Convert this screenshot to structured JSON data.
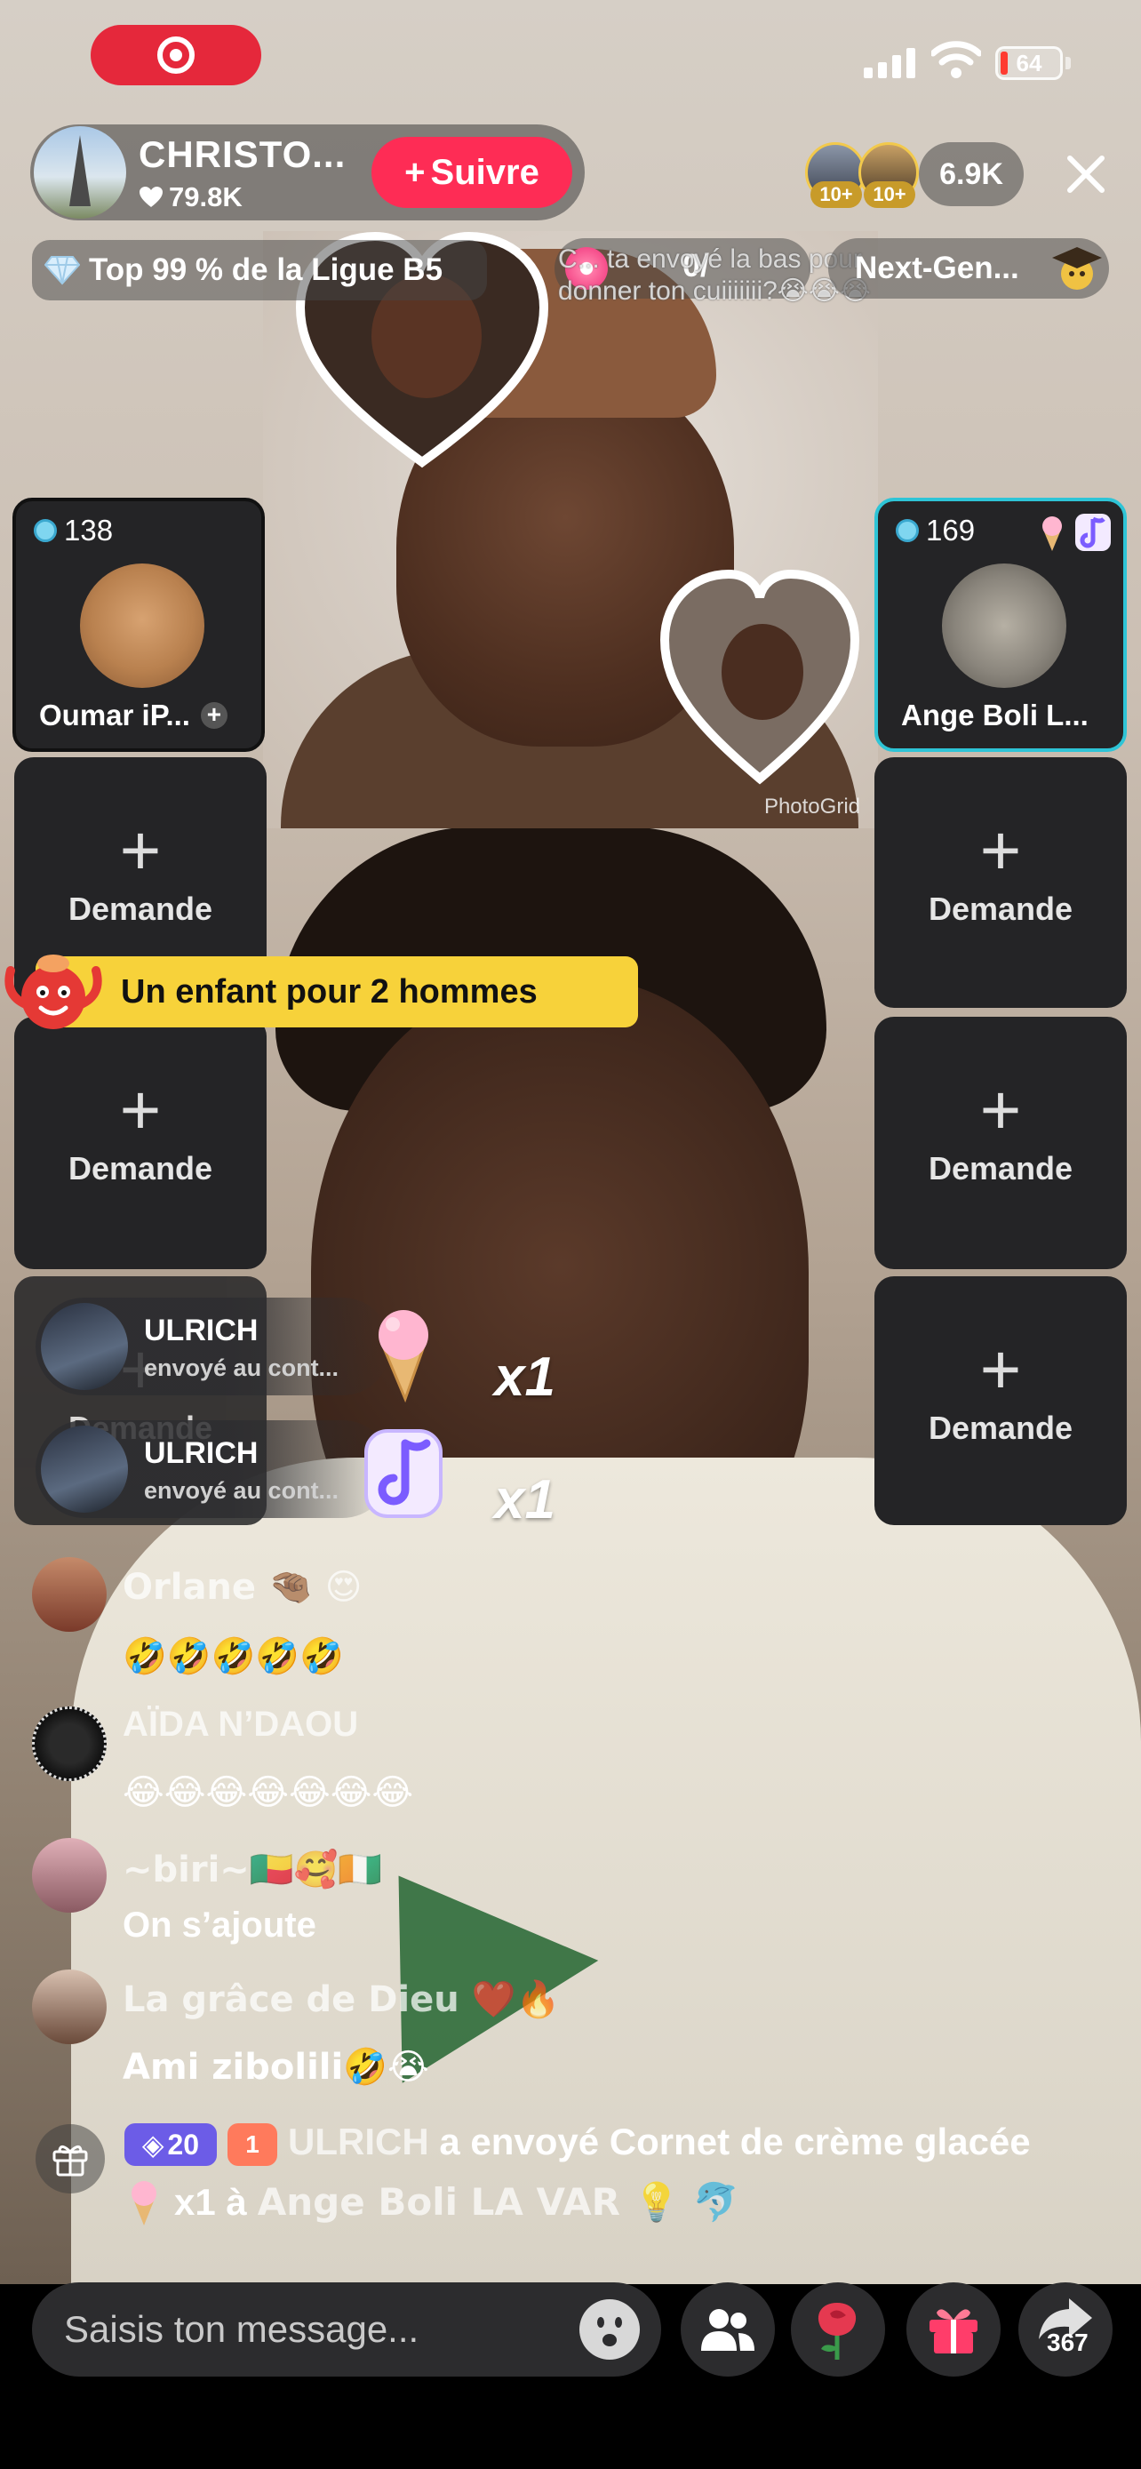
{
  "status_bar": {
    "battery": "64"
  },
  "host": {
    "name": "CHRISTO...",
    "likes": "79.8K",
    "follow_label": "Suivre",
    "viewer_badges": [
      "10+",
      "10+"
    ],
    "viewer_count": "6.9K"
  },
  "league": {
    "label": "Top 99 % de la Ligue B5"
  },
  "gift_goal": {
    "count": "0/"
  },
  "overlay_caption": "C... ta envoyé la bas pour donner ton cuiiiiiii?😭😭😭",
  "ranking": {
    "label": "Next-Gen..."
  },
  "video": {
    "watermark": "PhotoGrid"
  },
  "guests": {
    "left_active": {
      "score": "138",
      "name": "Oumar iP..."
    },
    "right_active": {
      "score": "169",
      "name": "Ange Boli L..."
    },
    "request_label": "Demande"
  },
  "topic": {
    "label": "Un enfant pour 2 hommes"
  },
  "gift_combos": [
    {
      "user": "ULRICH",
      "desc": "envoyé au cont...",
      "multiplier": "x1",
      "gift_icon": "ice-cream-icon"
    },
    {
      "user": "ULRICH",
      "desc": "envoyé au cont...",
      "multiplier": "x1",
      "gift_icon": "music-note-icon"
    }
  ],
  "chat": [
    {
      "name": "Orlane 🤏🏾 😍",
      "message": "🤣🤣🤣🤣🤣"
    },
    {
      "name": "AÏDA N’DAOU",
      "message": "😂😂😂😂😂😂😂"
    },
    {
      "name": "~biri~🇧🇯🥰🇨🇮",
      "message": "On s’ajoute"
    },
    {
      "name": "La grâce de Dieu ❤️🔥",
      "message": "Ami zibolili🤣😭"
    }
  ],
  "gift_notice": {
    "level": "20",
    "fan_level": "1",
    "user": "ULRICH",
    "action": "a envoyé Cornet de crème glacée",
    "count": "x1 à",
    "recipient": "Ange Boli LA VAR 💡 🐬"
  },
  "input": {
    "placeholder": "Saisis ton message..."
  },
  "actions": {
    "share_count": "367"
  },
  "colors": {
    "follow": "#fe2c55",
    "topic_banner": "#f7d23a",
    "active_tile_border": "#2ec4d6",
    "level_badge": "#6c5ce7"
  }
}
